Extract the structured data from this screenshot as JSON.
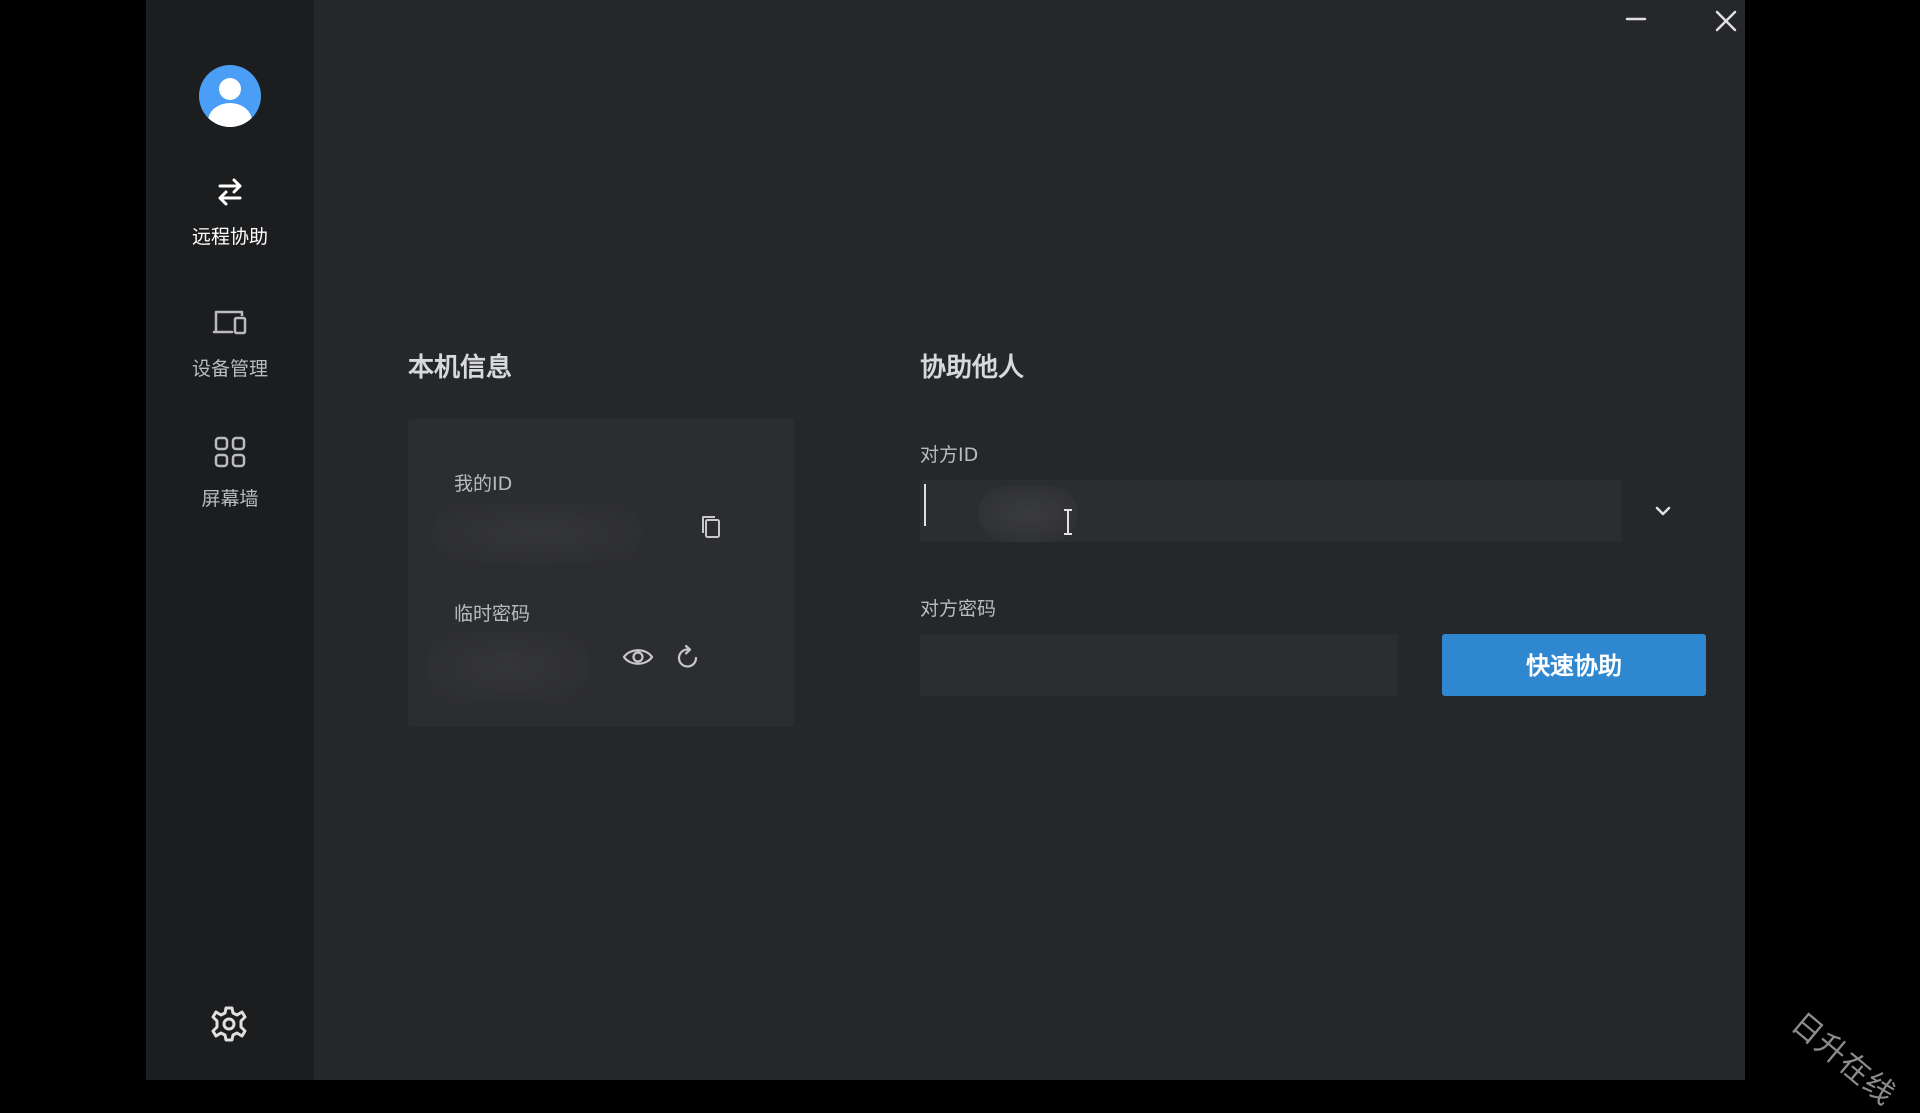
{
  "sidebar": {
    "items": [
      {
        "label": "远程协助",
        "icon": "swap-arrows-icon",
        "active": true
      },
      {
        "label": "设备管理",
        "icon": "devices-icon",
        "active": false
      },
      {
        "label": "屏幕墙",
        "icon": "grid-icon",
        "active": false
      }
    ],
    "settings_icon": "gear-icon"
  },
  "local_info": {
    "title": "本机信息",
    "my_id_label": "我的ID",
    "temp_password_label": "临时密码"
  },
  "assist_others": {
    "title": "协助他人",
    "peer_id_label": "对方ID",
    "peer_password_label": "对方密码",
    "peer_id_value": "",
    "peer_password_value": "",
    "quick_assist_label": "快速协助"
  },
  "watermark": "日升在线",
  "colors": {
    "accent": "#2f87cf",
    "background": "#26272a",
    "sidebar": "#1c1d1f",
    "avatar": "#4a9ef5"
  }
}
